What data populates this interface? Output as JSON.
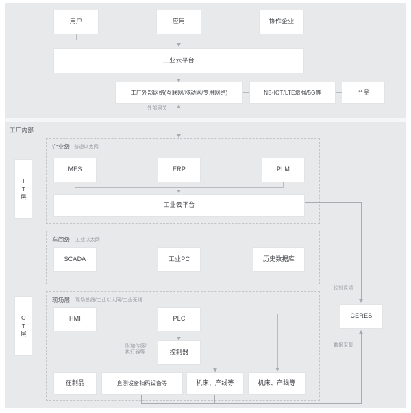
{
  "diagram": {
    "title_outside": "",
    "sections": {
      "inside_label": "工厂内部"
    },
    "lanes": {
      "it": "IT层",
      "ot": "OT层"
    },
    "groups": [
      {
        "title": "企业级",
        "subtitle": "普通以太网"
      },
      {
        "title": "车间级",
        "subtitle": "工业以太网"
      },
      {
        "title": "现场层",
        "subtitle": "现场总线/工业以太网/工业无线"
      }
    ],
    "nodes": {
      "user": "用户",
      "application": "应用",
      "partner": "协作企业",
      "cloud_top": "工业云平台",
      "ext_network": "工厂外部网络(互联网/移动网/专用网络)",
      "net_tech": "NB-IOT/LTE增强/5G等",
      "product": "产品",
      "mes": "MES",
      "erp": "ERP",
      "plm": "PLM",
      "cloud_it": "工业云平台",
      "scada": "SCADA",
      "industrial_pc": "工业PC",
      "historian": "历史数据库",
      "hmi": "HMI",
      "plc": "PLC",
      "controller": "控制器",
      "wip": "在制品",
      "scan_device": "直测设备扫码设备等",
      "machine_line_1": "机床、产线等",
      "machine_line_2": "机床、产线等",
      "ceres": "CERES"
    },
    "edge_labels": {
      "ext_gateway": "外部网关",
      "extra_sensor": "附加传感/\n执行器等",
      "extra_sensor_l1": "附加传感/",
      "extra_sensor_l2": "执行器等",
      "control_feedback": "控制反馈",
      "data_collection": "数据采集"
    },
    "colors": {
      "panel_bg": "#e8e9eb",
      "box_bg": "#ffffff",
      "box_border": "#e2e3e5",
      "line": "#b9bbc0",
      "text": "#44474c",
      "muted_text": "#9a9ea4",
      "dashed_border": "#c2c4c8"
    }
  }
}
